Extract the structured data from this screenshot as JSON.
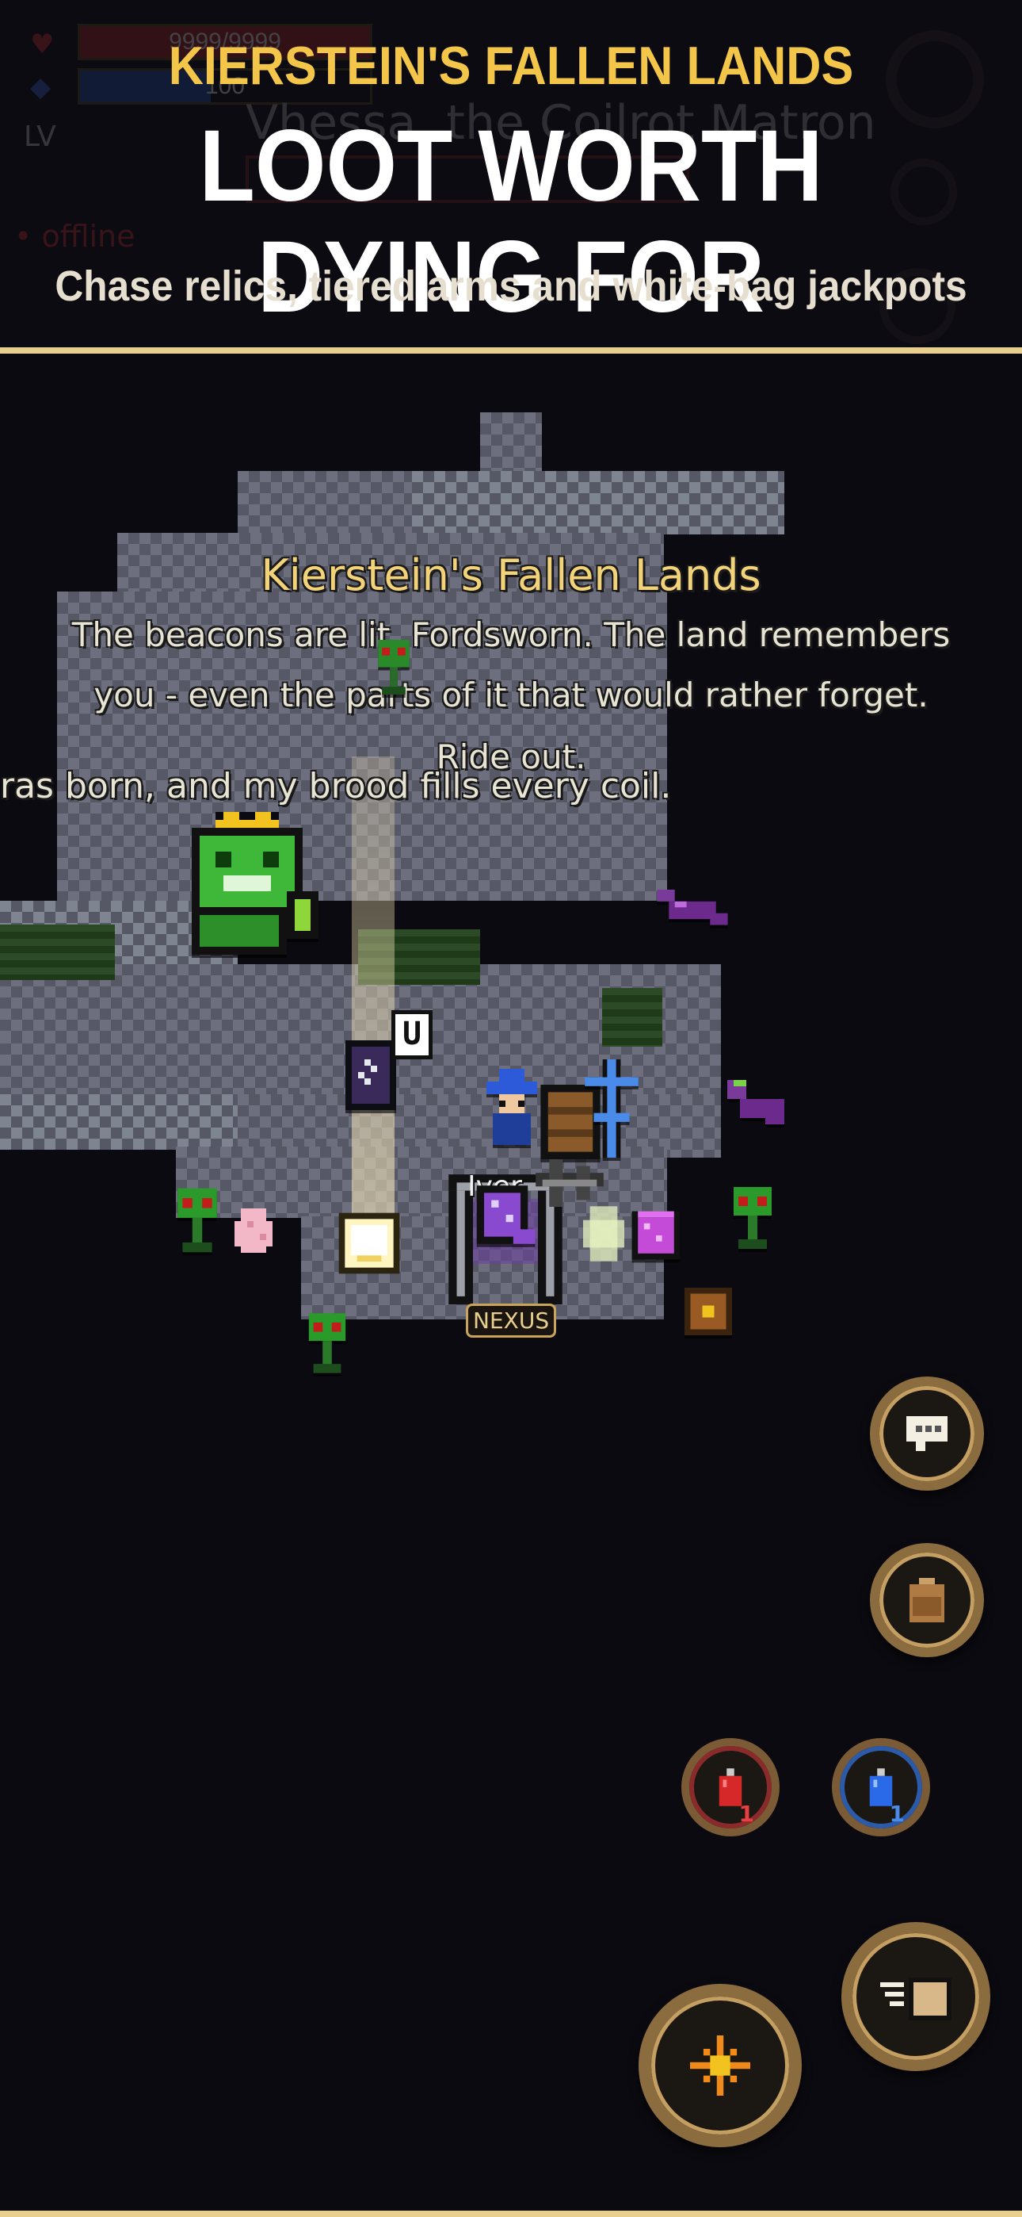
{
  "banner": {
    "tagline": "KIERSTEIN'S FALLEN LANDS",
    "headline": "LOOT WORTH DYING FOR",
    "subline": "Chase relics, tiered arms and white-bag jackpots"
  },
  "hud_background": {
    "hp_text": "9999/9999",
    "mp_text": "100",
    "level_text": "LV",
    "boss_name": "Vhessa, the Coilrot Matron",
    "status_text": "• offline",
    "colors": {
      "hp": "#b52a22",
      "mp": "#2a55b5"
    }
  },
  "world": {
    "zone_title": "Kierstein's Fallen Lands",
    "intro_line_1": "The beacons are lit, Fordsworn. The land remembers",
    "intro_line_2": "you - even the parts of it that would rather forget.",
    "intro_line_3": "Ride out.",
    "boss_speech": "ras born, and my brood fills every coil.",
    "player_name": "Iver",
    "portal_label": "NEXUS",
    "ground_item_marker": "U"
  },
  "controls": {
    "chat_icon": "chat-bubble-icon",
    "inventory_icon": "backpack-icon",
    "hp_potion_count": "1",
    "mp_potion_count": "1",
    "dash_icon": "speed-card-icon",
    "ability_icon": "sparkle-icon"
  },
  "colors": {
    "accent_gold": "#f3c64a",
    "banner_divider": "#e9cf8e",
    "button_ring": "#8a6c3f"
  }
}
